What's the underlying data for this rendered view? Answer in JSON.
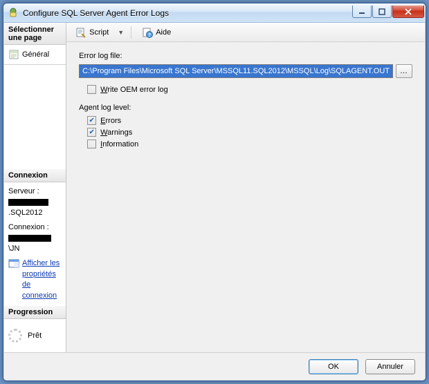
{
  "window": {
    "title": "Configure SQL Server Agent Error Logs"
  },
  "sidebar": {
    "select_page_header": "Sélectionner une page",
    "general_label": "Général",
    "connection_header": "Connexion",
    "server_label": "Serveur :",
    "server_value_suffix": ".SQL2012",
    "connection_label": "Connexion :",
    "connection_value_suffix": "\\JN",
    "view_props_link": "Afficher les propriétés de connexion",
    "progress_header": "Progression",
    "progress_status": "Prêt"
  },
  "toolbar": {
    "script_label": "Script",
    "help_label": "Aide"
  },
  "content": {
    "error_log_file_label": "Error log file:",
    "error_log_path": "C:\\Program Files\\Microsoft SQL Server\\MSSQL11.SQL2012\\MSSQL\\Log\\SQLAGENT.OUT",
    "write_oem_prefix": "W",
    "write_oem_rest": "rite OEM error log",
    "agent_log_level_label": "Agent log level:",
    "errors_prefix": "E",
    "errors_rest": "rrors",
    "warnings_prefix": "W",
    "warnings_rest": "arnings",
    "information_prefix": "I",
    "information_rest": "nformation"
  },
  "buttons": {
    "ok": "OK",
    "cancel": "Annuler"
  }
}
